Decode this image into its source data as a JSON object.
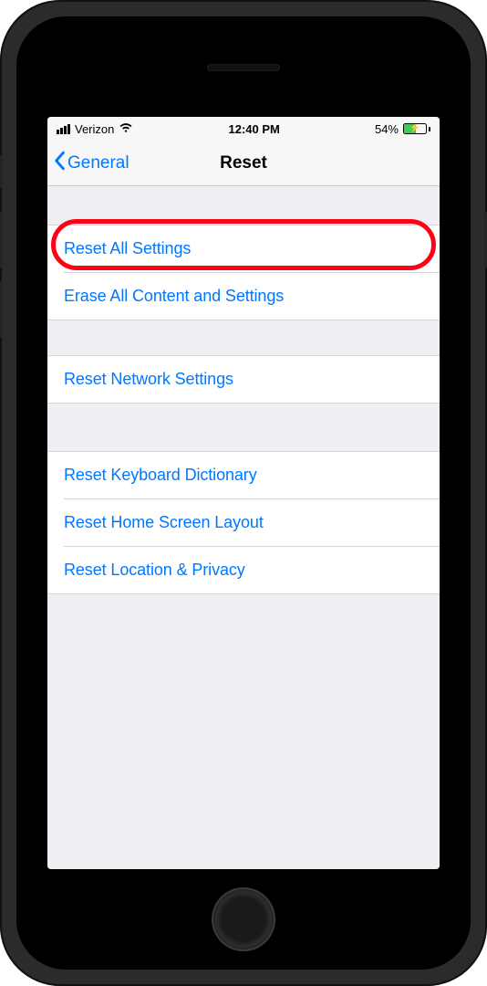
{
  "status": {
    "carrier": "Verizon",
    "time": "12:40 PM",
    "battery_pct": "54%"
  },
  "nav": {
    "back_label": "General",
    "title": "Reset"
  },
  "rows": {
    "reset_all": "Reset All Settings",
    "erase_all": "Erase All Content and Settings",
    "network": "Reset Network Settings",
    "keyboard": "Reset Keyboard Dictionary",
    "home": "Reset Home Screen Layout",
    "location": "Reset Location & Privacy"
  },
  "annotation": {
    "highlighted_row": "reset_all"
  }
}
